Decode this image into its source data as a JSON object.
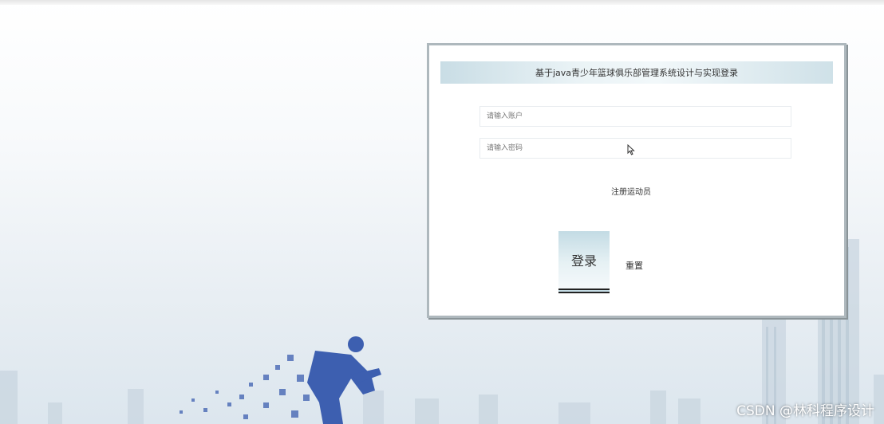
{
  "login": {
    "title": "基于java青少年篮球俱乐部管理系统设计与实现登录",
    "account_placeholder": "请输入账户",
    "password_placeholder": "请输入密码",
    "register_link": "注册运动员",
    "login_button": "登录",
    "reset_button": "重置"
  },
  "watermark": "CSDN @林科程序设计",
  "colors": {
    "title_bar": "#c9dde5",
    "card_border": "#aeb8bd",
    "runner": "#3d5fb0"
  },
  "icons": [
    "mouse-cursor-icon"
  ]
}
